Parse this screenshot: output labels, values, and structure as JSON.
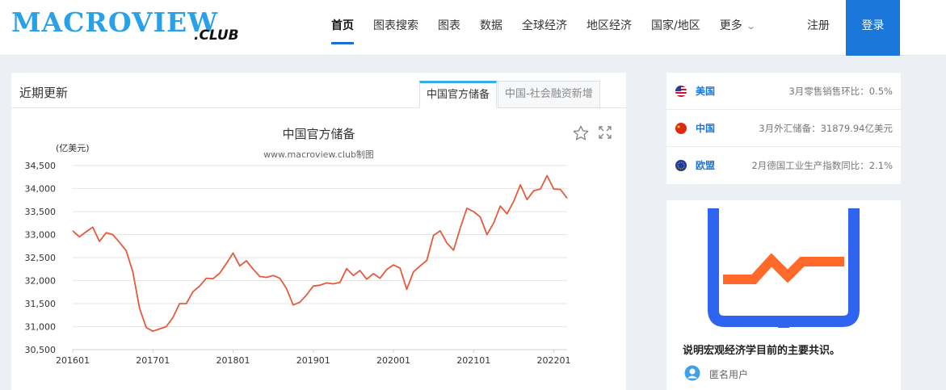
{
  "header": {
    "logo_main": "MACROVIEW",
    "logo_sub": ".CLUB",
    "nav": [
      "首页",
      "图表搜索",
      "图表",
      "数据",
      "全球经济",
      "地区经济",
      "国家/地区",
      "更多"
    ],
    "signup": "注册",
    "login": "登录",
    "brand_color": "#2aa0e6",
    "accent_color": "#1a76d8"
  },
  "panel": {
    "title": "近期更新",
    "tabs": [
      "中国官方储备",
      "中国-社会融资新增"
    ]
  },
  "chart_data": {
    "type": "line",
    "title": "中国官方储备",
    "subtitle": "www.macroview.club制图",
    "ylabel": "(亿美元)",
    "ylim": [
      30500,
      34500
    ],
    "yticks": [
      "34,500",
      "34,000",
      "33,500",
      "33,000",
      "32,500",
      "32,000",
      "31,500",
      "31,000",
      "30,500"
    ],
    "xticks": [
      "201601",
      "201701",
      "201801",
      "201901",
      "202001",
      "202101",
      "202201"
    ],
    "grid": true,
    "series_color": "#e55a3c",
    "series": [
      {
        "values": [
          33080,
          32950,
          33060,
          33160,
          32850,
          33040,
          33000,
          32830,
          32650,
          32190,
          31400,
          30980,
          30900,
          30950,
          31000,
          31200,
          31500,
          31500,
          31760,
          31880,
          32050,
          32040,
          32160,
          32370,
          32600,
          32320,
          32430,
          32250,
          32090,
          32070,
          32110,
          32050,
          31830,
          31470,
          31530,
          31690,
          31880,
          31900,
          31950,
          31930,
          31960,
          32260,
          32110,
          32220,
          32030,
          32150,
          32050,
          32240,
          32340,
          32270,
          31810,
          32190,
          32320,
          32440,
          32980,
          33080,
          32820,
          32660,
          33140,
          33570,
          33500,
          33380,
          33000,
          33250,
          33620,
          33450,
          33720,
          34080,
          33760,
          33950,
          33990,
          34280,
          33990,
          33980,
          33790
        ]
      }
    ]
  },
  "news": [
    {
      "country": "美国",
      "text": "3月零售销售环比：0.5%",
      "flag": "us-flag-icon"
    },
    {
      "country": "中国",
      "text": "3月外汇储备：31879.94亿美元",
      "flag": "cn-flag-icon"
    },
    {
      "country": "欧盟",
      "text": "2月德国工业生产指数同比：2.1%",
      "flag": "eu-flag-icon"
    }
  ],
  "card": {
    "title": "说明宏观经济学目前的主要共识。",
    "user": "匿名用户",
    "image": "pulse-screen-icon"
  }
}
